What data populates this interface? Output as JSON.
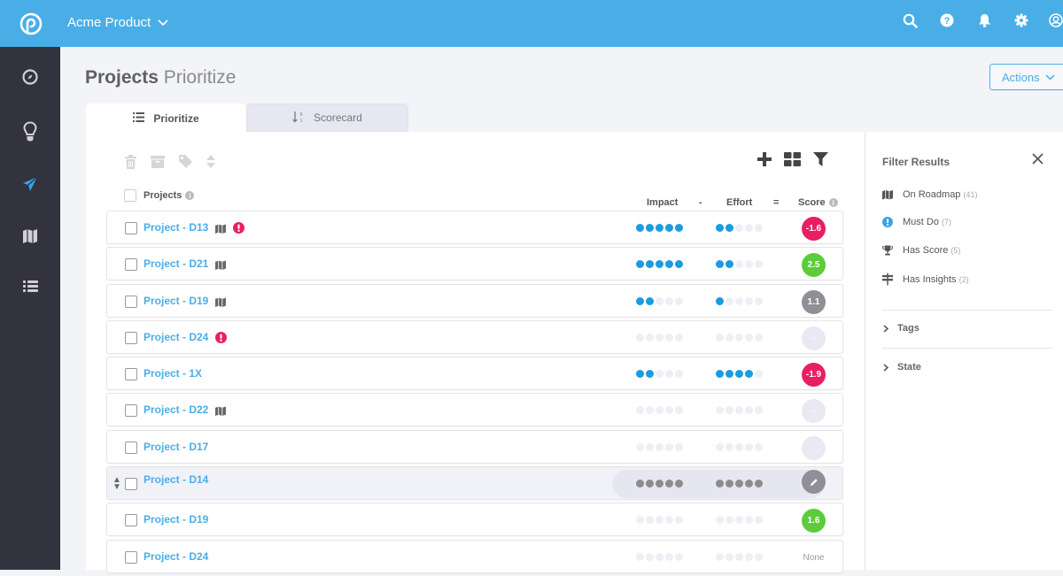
{
  "header": {
    "product_name": "Acme Product",
    "icons": [
      "search-icon",
      "help-icon",
      "bell-icon",
      "gear-icon",
      "user-avatar-icon"
    ]
  },
  "sidebar": {
    "items": [
      {
        "icon": "compass-icon",
        "active": false
      },
      {
        "icon": "lightbulb-icon",
        "active": false
      },
      {
        "icon": "paper-plane-icon",
        "active": true
      },
      {
        "icon": "map-icon",
        "active": false
      },
      {
        "icon": "list-icon",
        "active": false
      }
    ]
  },
  "page": {
    "title_bold": "Projects",
    "title_rest": "Prioritize",
    "actions_label": "Actions"
  },
  "tabs": [
    {
      "label": "Prioritize",
      "icon": "list-icon",
      "active": true
    },
    {
      "label": "Scorecard",
      "icon": "sort-numeric-icon",
      "active": false
    }
  ],
  "table": {
    "col_projects": "Projects",
    "col_impact": "Impact",
    "col_minus": "-",
    "col_effort": "Effort",
    "col_equals": "=",
    "col_score": "Score",
    "rows": [
      {
        "name": "Project - D13",
        "roadmap": true,
        "must_do": true,
        "impact": 5,
        "effort": 2,
        "score": "-1.6",
        "score_color": "#e91e63",
        "dots_style": "normal"
      },
      {
        "name": "Project - D21",
        "roadmap": true,
        "must_do": false,
        "impact": 5,
        "effort": 2,
        "score": "2.5",
        "score_color": "#5ccc3b",
        "dots_style": "normal"
      },
      {
        "name": "Project - D19",
        "roadmap": true,
        "must_do": false,
        "impact": 2,
        "effort": 1,
        "score": "1.1",
        "score_color": "#8f8f95",
        "dots_style": "normal"
      },
      {
        "name": "Project - D24",
        "roadmap": false,
        "must_do": true,
        "impact": 0,
        "effort": 0,
        "score": "-",
        "score_color": "#e8e9f2",
        "dots_style": "normal"
      },
      {
        "name": "Project - 1X",
        "roadmap": false,
        "must_do": false,
        "impact": 2,
        "effort": 4,
        "score": "-1.9",
        "score_color": "#e91e63",
        "dots_style": "normal"
      },
      {
        "name": "Project - D22",
        "roadmap": true,
        "must_do": false,
        "impact": 0,
        "effort": 0,
        "score": "-",
        "score_color": "#e8e9f2",
        "dots_style": "normal"
      },
      {
        "name": "Project - D17",
        "roadmap": false,
        "must_do": false,
        "impact": 0,
        "effort": 0,
        "score": "-",
        "score_color": "#e8e9f2",
        "dots_style": "normal"
      },
      {
        "name": "Project - D14",
        "roadmap": false,
        "must_do": false,
        "impact": 0,
        "effort": 0,
        "score": "edit",
        "score_color": "#8f8f95",
        "dots_style": "hover"
      },
      {
        "name": "Project - D19",
        "roadmap": false,
        "must_do": false,
        "impact": 0,
        "effort": 0,
        "score": "1.6",
        "score_color": "#5ccc3b",
        "dots_style": "normal"
      },
      {
        "name": "Project - D24",
        "roadmap": false,
        "must_do": false,
        "impact": 0,
        "effort": 0,
        "score": "None",
        "score_color": "",
        "dots_style": "normal"
      }
    ]
  },
  "filter": {
    "title": "Filter Results",
    "items": [
      {
        "icon": "map-icon",
        "label": "On Roadmap",
        "count": "(41)"
      },
      {
        "icon": "must-do-icon",
        "label": "Must Do",
        "count": "(7)"
      },
      {
        "icon": "trophy-icon",
        "label": "Has Score",
        "count": "(5)"
      },
      {
        "icon": "signpost-icon",
        "label": "Has Insights",
        "count": "(2)"
      }
    ],
    "sections": [
      "Tags",
      "State"
    ]
  },
  "colors": {
    "brand": "#4aaee6",
    "sidebar": "#33323f",
    "negative": "#e91e63",
    "positive": "#5ccc3b",
    "neutral": "#8f8f95"
  }
}
